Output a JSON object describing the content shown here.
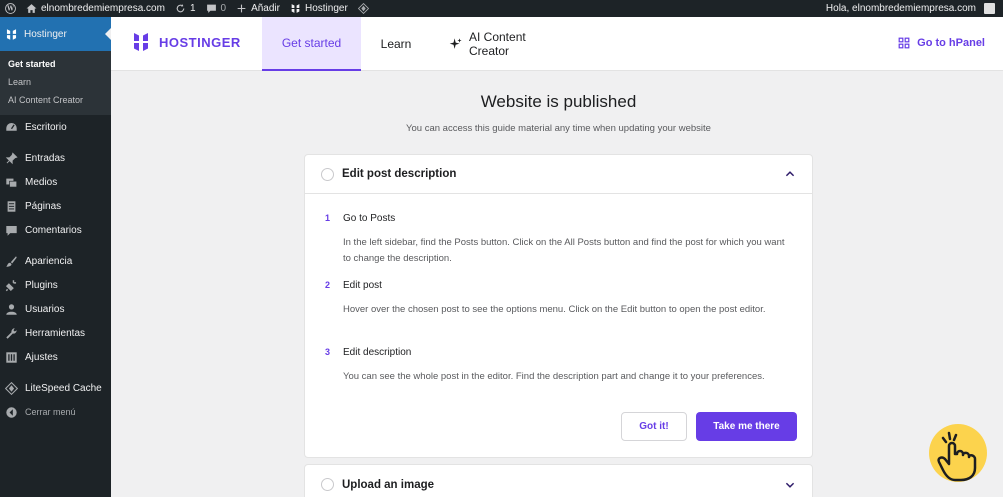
{
  "adminbar": {
    "site_name": "elnombredemiempresa.com",
    "updates_count": "1",
    "comments_count": "0",
    "add_new": "Añadir",
    "hostinger": "Hostinger",
    "greeting": "Hola, elnombredemiempresa.com"
  },
  "sidebar": {
    "hostinger": "Hostinger",
    "submenu": [
      "Get started",
      "Learn",
      "AI Content Creator"
    ],
    "items": {
      "escritorio": "Escritorio",
      "entradas": "Entradas",
      "medios": "Medios",
      "paginas": "Páginas",
      "comentarios": "Comentarios",
      "apariencia": "Apariencia",
      "plugins": "Plugins",
      "usuarios": "Usuarios",
      "herramientas": "Herramientas",
      "ajustes": "Ajustes",
      "litespeed": "LiteSpeed Cache",
      "collapse": "Cerrar menú"
    }
  },
  "header": {
    "logo": "HOSTINGER",
    "tabs": [
      "Get started",
      "Learn",
      "AI Content Creator"
    ],
    "active_tab": "Get started",
    "hpanel": "Go to hPanel"
  },
  "main": {
    "title": "Website is published",
    "subtitle": "You can access this guide material any time when updating your website",
    "card1": {
      "title": "Edit post description",
      "steps": [
        {
          "num": "1",
          "title": "Go to Posts",
          "desc": "In the left sidebar, find the Posts button. Click on the All Posts button and find the post for which you want to change the description."
        },
        {
          "num": "2",
          "title": "Edit post",
          "desc": "Hover over the chosen post to see the options menu. Click on the Edit button to open the post editor."
        },
        {
          "num": "3",
          "title": "Edit description",
          "desc": "You can see the whole post in the editor. Find the description part and change it to your preferences."
        }
      ],
      "got_it": "Got it!",
      "take_me": "Take me there"
    },
    "card2": {
      "title": "Upload an image"
    }
  },
  "colors": {
    "brand": "#673de6",
    "admin_bg": "#1d2327",
    "wp_blue": "#2271b1",
    "helper_yellow": "#fcd34d"
  }
}
